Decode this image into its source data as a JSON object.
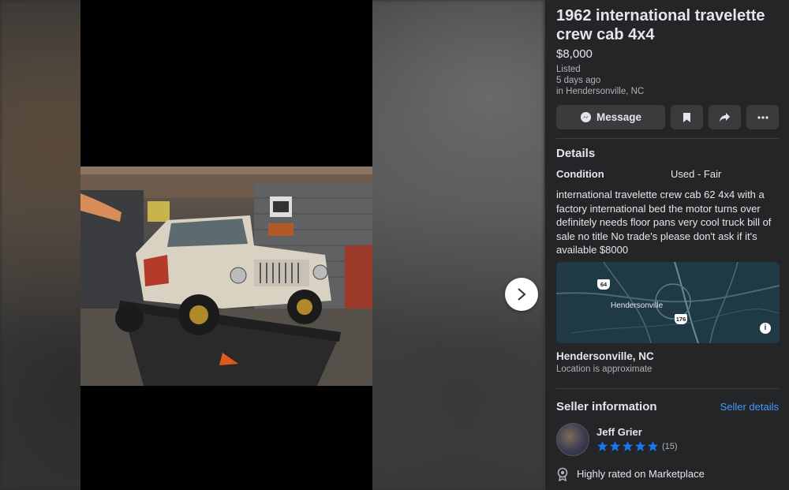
{
  "listing": {
    "title": "1962 international travelette crew cab 4x4",
    "price": "$8,000",
    "listed_label": "Listed",
    "listed_time": "5 days ago",
    "listed_location": "in Hendersonville, NC"
  },
  "actions": {
    "message_label": "Message",
    "save_icon": "bookmark-icon",
    "share_icon": "share-icon",
    "more_icon": "more-icon"
  },
  "details": {
    "heading": "Details",
    "condition_label": "Condition",
    "condition_value": "Used - Fair",
    "description": "international travelette crew cab 62 4x4 with a factory international bed the motor turns over definitely needs floor pans very cool truck bill of sale no title No trade's please don't ask if it's available $8000"
  },
  "map": {
    "city_label": "Hendersonville",
    "route_a": "64",
    "route_b": "176"
  },
  "location": {
    "city": "Hendersonville, NC",
    "note": "Location is approximate"
  },
  "seller": {
    "heading": "Seller information",
    "details_link": "Seller details",
    "name": "Jeff Grier",
    "rating": 5,
    "rating_count": "(15)",
    "badge": "Highly rated on Marketplace"
  },
  "colors": {
    "panel_bg": "#242526",
    "accent_blue": "#4599ff",
    "star_blue": "#1877f2"
  }
}
